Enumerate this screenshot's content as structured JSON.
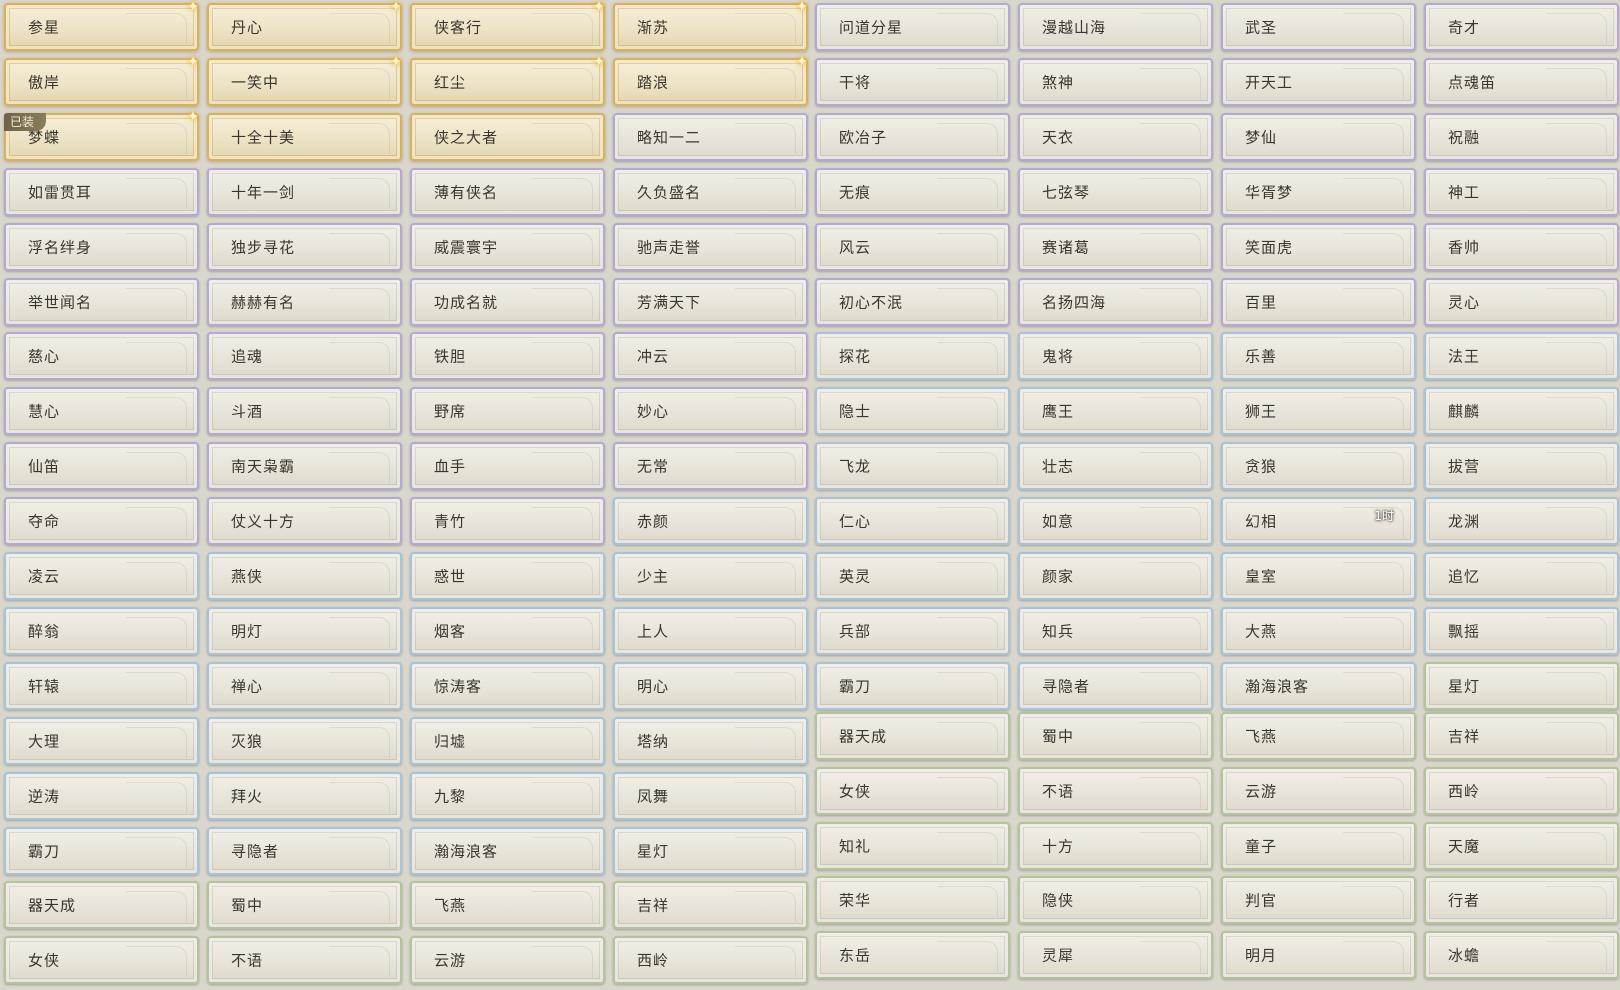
{
  "equipped_label": "已装",
  "columns": [
    {
      "tiles": [
        {
          "label": "参星",
          "tier": "gold",
          "new": true
        },
        {
          "label": "傲岸",
          "tier": "gold",
          "new": true
        },
        {
          "label": "梦蝶",
          "tier": "gold",
          "new": true,
          "equipped": true
        },
        {
          "label": "如雷贯耳",
          "tier": "purple"
        },
        {
          "label": "浮名绊身",
          "tier": "purple"
        },
        {
          "label": "举世闻名",
          "tier": "purple"
        },
        {
          "label": "慈心",
          "tier": "purple"
        },
        {
          "label": "慧心",
          "tier": "purple"
        },
        {
          "label": "仙笛",
          "tier": "purple"
        },
        {
          "label": "夺命",
          "tier": "purple"
        },
        {
          "label": "凌云",
          "tier": "blue"
        },
        {
          "label": "醉翁",
          "tier": "blue"
        },
        {
          "label": "轩辕",
          "tier": "blue"
        },
        {
          "label": "大理",
          "tier": "blue"
        },
        {
          "label": "逆涛",
          "tier": "blue"
        },
        {
          "label": "霸刀",
          "tier": "blue"
        },
        {
          "label": "器天成",
          "tier": "green"
        },
        {
          "label": "女侠",
          "tier": "green"
        }
      ]
    },
    {
      "tiles": [
        {
          "label": "丹心",
          "tier": "gold",
          "new": true
        },
        {
          "label": "一笑中",
          "tier": "gold",
          "new": true
        },
        {
          "label": "十全十美",
          "tier": "gold"
        },
        {
          "label": "十年一剑",
          "tier": "purple"
        },
        {
          "label": "独步寻花",
          "tier": "purple"
        },
        {
          "label": "赫赫有名",
          "tier": "purple"
        },
        {
          "label": "追魂",
          "tier": "purple"
        },
        {
          "label": "斗酒",
          "tier": "purple"
        },
        {
          "label": "南天枭霸",
          "tier": "purple"
        },
        {
          "label": "仗义十方",
          "tier": "purple"
        },
        {
          "label": "燕侠",
          "tier": "blue"
        },
        {
          "label": "明灯",
          "tier": "blue"
        },
        {
          "label": "禅心",
          "tier": "blue"
        },
        {
          "label": "灭狼",
          "tier": "blue"
        },
        {
          "label": "拜火",
          "tier": "blue"
        },
        {
          "label": "寻隐者",
          "tier": "blue"
        },
        {
          "label": "蜀中",
          "tier": "green"
        },
        {
          "label": "不语",
          "tier": "green"
        }
      ]
    },
    {
      "tiles": [
        {
          "label": "侠客行",
          "tier": "gold",
          "new": true
        },
        {
          "label": "红尘",
          "tier": "gold",
          "new": true
        },
        {
          "label": "侠之大者",
          "tier": "gold"
        },
        {
          "label": "薄有侠名",
          "tier": "purple"
        },
        {
          "label": "威震寰宇",
          "tier": "purple"
        },
        {
          "label": "功成名就",
          "tier": "purple"
        },
        {
          "label": "铁胆",
          "tier": "purple"
        },
        {
          "label": "野席",
          "tier": "purple"
        },
        {
          "label": "血手",
          "tier": "purple"
        },
        {
          "label": "青竹",
          "tier": "purple"
        },
        {
          "label": "惑世",
          "tier": "blue"
        },
        {
          "label": "烟客",
          "tier": "blue"
        },
        {
          "label": "惊涛客",
          "tier": "blue"
        },
        {
          "label": "归墟",
          "tier": "blue"
        },
        {
          "label": "九黎",
          "tier": "blue"
        },
        {
          "label": "瀚海浪客",
          "tier": "blue"
        },
        {
          "label": "飞燕",
          "tier": "green"
        },
        {
          "label": "云游",
          "tier": "green"
        }
      ]
    },
    {
      "tiles": [
        {
          "label": "渐苏",
          "tier": "gold",
          "new": true
        },
        {
          "label": "踏浪",
          "tier": "gold",
          "new": true
        },
        {
          "label": "略知一二",
          "tier": "purple"
        },
        {
          "label": "久负盛名",
          "tier": "purple"
        },
        {
          "label": "驰声走誉",
          "tier": "purple"
        },
        {
          "label": "芳满天下",
          "tier": "purple"
        },
        {
          "label": "冲云",
          "tier": "purple"
        },
        {
          "label": "妙心",
          "tier": "purple"
        },
        {
          "label": "无常",
          "tier": "purple"
        },
        {
          "label": "赤颜",
          "tier": "blue"
        },
        {
          "label": "少主",
          "tier": "blue"
        },
        {
          "label": "上人",
          "tier": "blue"
        },
        {
          "label": "明心",
          "tier": "blue"
        },
        {
          "label": "塔纳",
          "tier": "blue"
        },
        {
          "label": "凤舞",
          "tier": "blue"
        },
        {
          "label": "星灯",
          "tier": "blue"
        },
        {
          "label": "吉祥",
          "tier": "green"
        },
        {
          "label": "西岭",
          "tier": "green"
        }
      ]
    },
    {
      "tiles": [
        {
          "label": "问道分星",
          "tier": "purple"
        },
        {
          "label": "干将",
          "tier": "purple"
        },
        {
          "label": "欧冶子",
          "tier": "purple"
        },
        {
          "label": "无痕",
          "tier": "purple"
        },
        {
          "label": "风云",
          "tier": "purple"
        },
        {
          "label": "初心不泯",
          "tier": "purple"
        },
        {
          "label": "探花",
          "tier": "blue"
        },
        {
          "label": "隐士",
          "tier": "blue"
        },
        {
          "label": "飞龙",
          "tier": "blue"
        },
        {
          "label": "仁心",
          "tier": "blue"
        },
        {
          "label": "英灵",
          "tier": "blue"
        },
        {
          "label": "兵部",
          "tier": "blue"
        },
        {
          "label": "霸刀",
          "tier": "blue"
        },
        {
          "label": "器天成",
          "tier": "green"
        },
        {
          "label": "女侠",
          "tier": "green"
        },
        {
          "label": "知礼",
          "tier": "green"
        },
        {
          "label": "荣华",
          "tier": "green"
        },
        {
          "label": "东岳",
          "tier": "green"
        }
      ]
    },
    {
      "tiles": [
        {
          "label": "漫越山海",
          "tier": "purple"
        },
        {
          "label": "煞神",
          "tier": "purple"
        },
        {
          "label": "天衣",
          "tier": "purple"
        },
        {
          "label": "七弦琴",
          "tier": "purple"
        },
        {
          "label": "赛诸葛",
          "tier": "purple"
        },
        {
          "label": "名扬四海",
          "tier": "purple"
        },
        {
          "label": "鬼将",
          "tier": "blue"
        },
        {
          "label": "鹰王",
          "tier": "blue"
        },
        {
          "label": "壮志",
          "tier": "blue"
        },
        {
          "label": "如意",
          "tier": "blue"
        },
        {
          "label": "颜家",
          "tier": "blue"
        },
        {
          "label": "知兵",
          "tier": "blue"
        },
        {
          "label": "寻隐者",
          "tier": "blue"
        },
        {
          "label": "蜀中",
          "tier": "green"
        },
        {
          "label": "不语",
          "tier": "green"
        },
        {
          "label": "十方",
          "tier": "green"
        },
        {
          "label": "隐侠",
          "tier": "green"
        },
        {
          "label": "灵犀",
          "tier": "green"
        }
      ]
    },
    {
      "tiles": [
        {
          "label": "武圣",
          "tier": "purple"
        },
        {
          "label": "开天工",
          "tier": "purple"
        },
        {
          "label": "梦仙",
          "tier": "purple"
        },
        {
          "label": "华胥梦",
          "tier": "purple"
        },
        {
          "label": "笑面虎",
          "tier": "purple"
        },
        {
          "label": "百里",
          "tier": "purple"
        },
        {
          "label": "乐善",
          "tier": "blue"
        },
        {
          "label": "狮王",
          "tier": "blue"
        },
        {
          "label": "贪狼",
          "tier": "blue"
        },
        {
          "label": "幻相",
          "tier": "blue",
          "timer": "1时"
        },
        {
          "label": "皇室",
          "tier": "blue"
        },
        {
          "label": "大燕",
          "tier": "blue"
        },
        {
          "label": "瀚海浪客",
          "tier": "blue"
        },
        {
          "label": "飞燕",
          "tier": "green"
        },
        {
          "label": "云游",
          "tier": "green"
        },
        {
          "label": "童子",
          "tier": "green"
        },
        {
          "label": "判官",
          "tier": "green"
        },
        {
          "label": "明月",
          "tier": "green"
        }
      ]
    },
    {
      "tiles": [
        {
          "label": "奇才",
          "tier": "purple"
        },
        {
          "label": "点魂笛",
          "tier": "purple"
        },
        {
          "label": "祝融",
          "tier": "purple"
        },
        {
          "label": "神工",
          "tier": "purple"
        },
        {
          "label": "香帅",
          "tier": "purple"
        },
        {
          "label": "灵心",
          "tier": "purple"
        },
        {
          "label": "法王",
          "tier": "blue"
        },
        {
          "label": "麒麟",
          "tier": "blue"
        },
        {
          "label": "拔营",
          "tier": "blue"
        },
        {
          "label": "龙渊",
          "tier": "blue"
        },
        {
          "label": "追忆",
          "tier": "blue"
        },
        {
          "label": "飘摇",
          "tier": "blue"
        },
        {
          "label": "星灯",
          "tier": "green"
        },
        {
          "label": "吉祥",
          "tier": "green"
        },
        {
          "label": "西岭",
          "tier": "green"
        },
        {
          "label": "天魔",
          "tier": "green"
        },
        {
          "label": "行者",
          "tier": "green"
        },
        {
          "label": "冰蟾",
          "tier": "green"
        }
      ]
    }
  ]
}
